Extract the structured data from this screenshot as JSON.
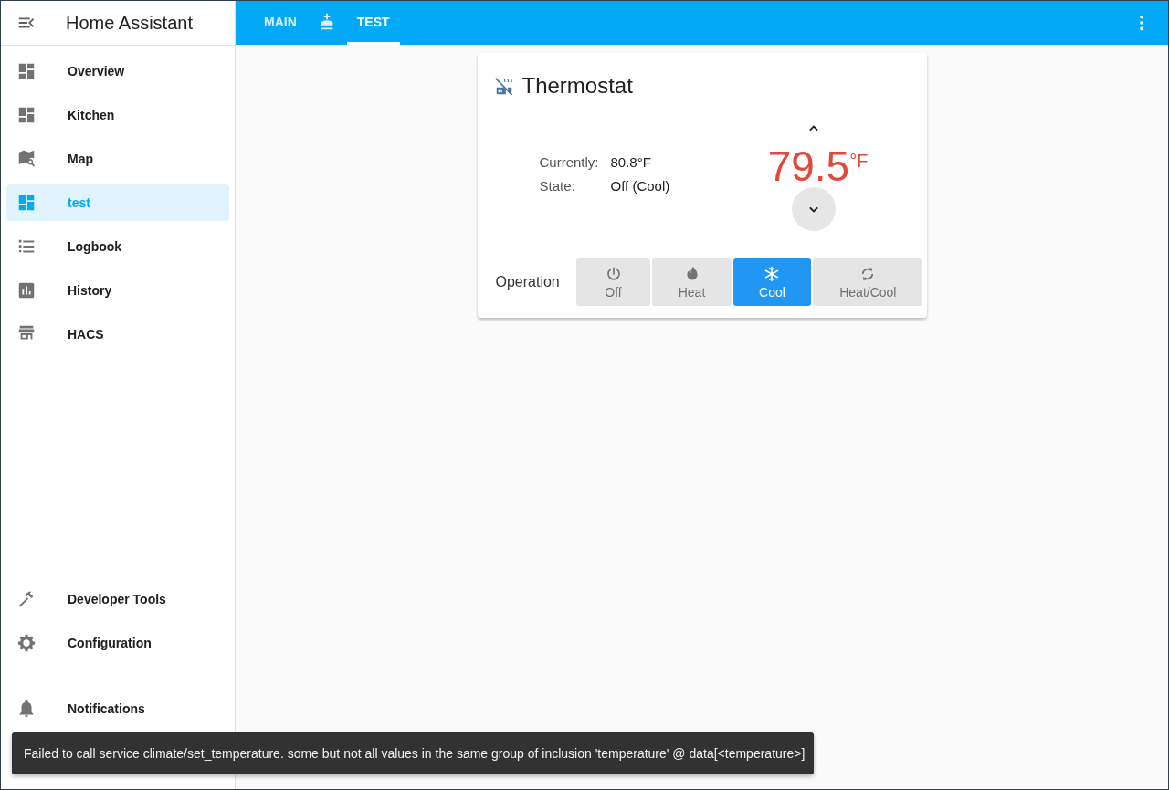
{
  "sidebar": {
    "title": "Home Assistant",
    "items": [
      {
        "label": "Overview",
        "kind": "dashboard",
        "selected": false
      },
      {
        "label": "Kitchen",
        "kind": "dashboard",
        "selected": false
      },
      {
        "label": "Map",
        "kind": "map",
        "selected": false
      },
      {
        "label": "test",
        "kind": "dashboard",
        "selected": true
      },
      {
        "label": "Logbook",
        "kind": "logbook",
        "selected": false
      },
      {
        "label": "History",
        "kind": "history",
        "selected": false
      },
      {
        "label": "HACS",
        "kind": "hacs",
        "selected": false
      }
    ],
    "bottom_items": [
      {
        "label": "Developer Tools",
        "kind": "tools",
        "selected": false
      },
      {
        "label": "Configuration",
        "kind": "config",
        "selected": false
      }
    ],
    "notifications": {
      "label": "Notifications"
    }
  },
  "tabs": [
    {
      "kind": "text",
      "label": "MAIN",
      "selected": false
    },
    {
      "kind": "icon",
      "selected": false
    },
    {
      "kind": "text",
      "label": "TEST",
      "selected": true
    }
  ],
  "thermostat": {
    "title": "Thermostat",
    "info": [
      {
        "label": "Currently:",
        "value": "80.8°F"
      },
      {
        "label": "State:",
        "value": "Off (Cool)"
      }
    ],
    "target": "79.5",
    "unit": "°F",
    "steppers": [
      {
        "kind": "up",
        "highlighted": false
      },
      {
        "kind": "down",
        "highlighted": true
      }
    ],
    "operation_label": "Operation",
    "modes": [
      {
        "kind": "off",
        "label": "Off",
        "selected": false
      },
      {
        "kind": "heat",
        "label": "Heat",
        "selected": false
      },
      {
        "kind": "cool",
        "label": "Cool",
        "selected": true
      },
      {
        "kind": "heat_cool",
        "label": "Heat/Cool",
        "selected": false
      }
    ]
  },
  "toast": {
    "message": "Failed to call service climate/set_temperature. some but not all values in the same group of inclusion 'temperature' @ data[<temperature>]"
  }
}
